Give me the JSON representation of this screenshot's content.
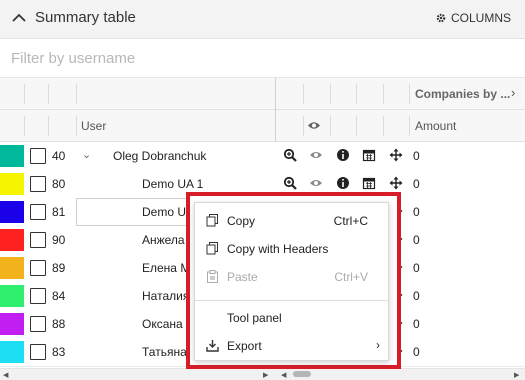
{
  "header": {
    "title": "Summary table",
    "columns_label": "COLUMNS"
  },
  "filter": {
    "placeholder": "Filter by username",
    "value": ""
  },
  "grid": {
    "group_header": "Companies by ...",
    "user_header": "User",
    "amount_header": "Amount",
    "rows": [
      {
        "color": "#00b99a",
        "id": "40",
        "user": "Oleg Dobranchuk",
        "amount": "0",
        "expand": true
      },
      {
        "color": "#f5f500",
        "id": "80",
        "user": "Demo UA 1",
        "amount": "0"
      },
      {
        "color": "#1a00e8",
        "id": "81",
        "user": "Demo UA",
        "amount": "0"
      },
      {
        "color": "#ff2020",
        "id": "90",
        "user": "Анжела",
        "amount": "0"
      },
      {
        "color": "#f2b21c",
        "id": "89",
        "user": "Елена М",
        "amount": "0"
      },
      {
        "color": "#31ef6e",
        "id": "84",
        "user": "Наталия",
        "amount": "0"
      },
      {
        "color": "#c11ef2",
        "id": "88",
        "user": "Оксана",
        "amount": "0"
      },
      {
        "color": "#1ddef2",
        "id": "83",
        "user": "Татьяна",
        "amount": "0"
      }
    ]
  },
  "context_menu": {
    "copy": {
      "label": "Copy",
      "shortcut": "Ctrl+C"
    },
    "copy_headers": {
      "label": "Copy with Headers"
    },
    "paste": {
      "label": "Paste",
      "shortcut": "Ctrl+V"
    },
    "tool_panel": {
      "label": "Tool panel"
    },
    "export": {
      "label": "Export"
    }
  }
}
